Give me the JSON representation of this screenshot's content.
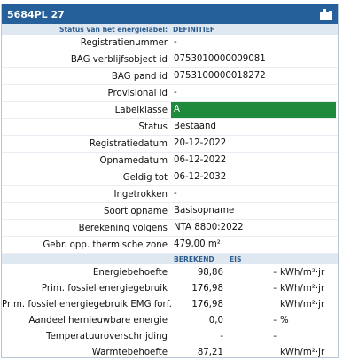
{
  "title": "5684PL 27",
  "header": {
    "status_label": "Status van het energielabel:",
    "status_value": "DEFINITIEF"
  },
  "fields": [
    {
      "label": "Registratienummer",
      "value": "-"
    },
    {
      "label": "BAG verblijfsobject id",
      "value": "0753010000009081"
    },
    {
      "label": "BAG pand id",
      "value": "0753100000018272"
    },
    {
      "label": "Provisional id",
      "value": "-"
    },
    {
      "label": "Labelklasse",
      "value": "A",
      "highlight": "#1f8a3b"
    },
    {
      "label": "Status",
      "value": "Bestaand"
    },
    {
      "label": "Registratiedatum",
      "value": "20-12-2022"
    },
    {
      "label": "Opnamedatum",
      "value": "06-12-2022"
    },
    {
      "label": "Geldig tot",
      "value": "06-12-2032"
    },
    {
      "label": "Ingetrokken",
      "value": "-"
    },
    {
      "label": "Soort opname",
      "value": "Basisopname"
    },
    {
      "label": "Berekening volgens",
      "value": "NTA 8800:2022"
    },
    {
      "label": "Gebr. opp. thermische zone",
      "value": "479,00 m²"
    }
  ],
  "energy_header": {
    "berekend": "BEREKEND",
    "eis": "EIS"
  },
  "energy_rows": [
    {
      "label": "Energiebehoefte",
      "berekend": "98,86",
      "eis": "-",
      "unit": "kWh/m²·jr"
    },
    {
      "label": "Prim. fossiel energiegebruik",
      "berekend": "176,98",
      "eis": "-",
      "unit": "kWh/m²·jr"
    },
    {
      "label": "Prim. fossiel energiegebruik EMG forf.",
      "berekend": "176,98",
      "eis": "",
      "unit": "kWh/m²·jr"
    },
    {
      "label": "Aandeel hernieuwbare energie",
      "berekend": "0,0",
      "eis": "-",
      "unit": "%"
    },
    {
      "label": "Temperatuuroverschrijding",
      "berekend": "-",
      "eis": "-",
      "unit": ""
    },
    {
      "label": "Warmtebehoefte",
      "berekend": "87,21",
      "eis": "",
      "unit": "kWh/m²·jr"
    }
  ]
}
